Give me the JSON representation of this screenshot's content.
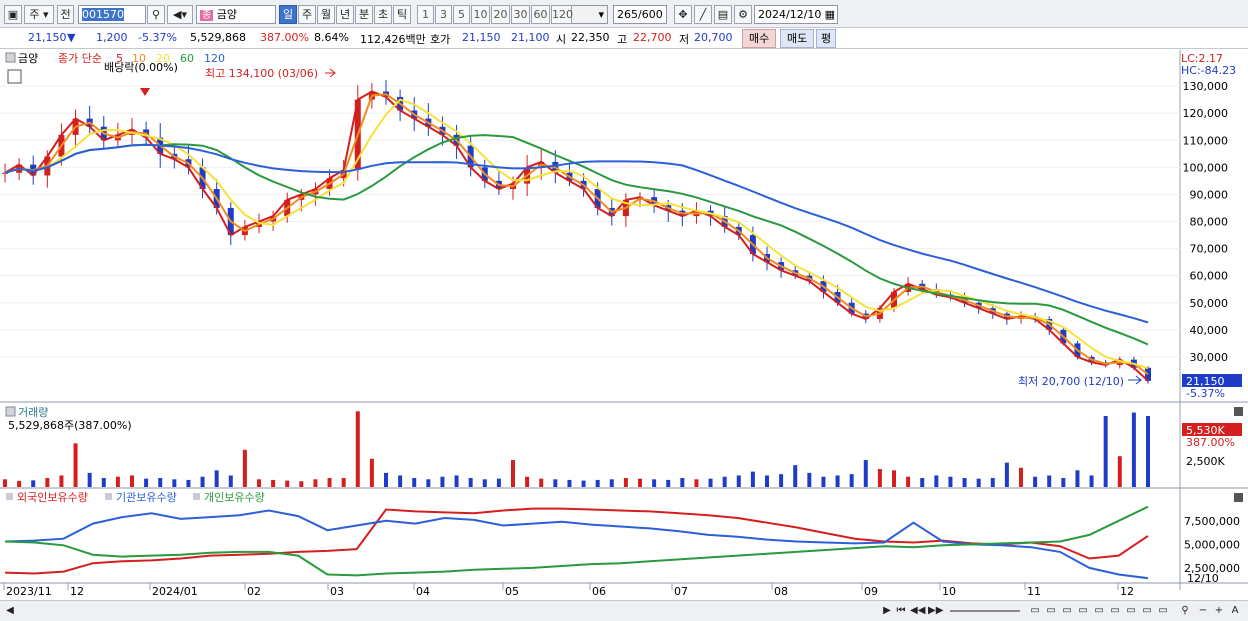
{
  "toolbar": {
    "period_mode": "주",
    "prev_label": "전",
    "stock_code": "001570",
    "stock_name": "금양",
    "intervals": [
      "일",
      "주",
      "월",
      "년",
      "분",
      "초",
      "틱"
    ],
    "active_interval": "일",
    "numbers": [
      "1",
      "3",
      "5",
      "10",
      "20",
      "30",
      "60",
      "120"
    ],
    "count_value": "265",
    "count_total": "/600",
    "date": "2024/12/10"
  },
  "quote": {
    "price": "21,150",
    "change": "1,200",
    "change_pct": "-5.37%",
    "volume": "5,529,868",
    "volume_pct": "387.00%",
    "turnover": "8.64%",
    "amount": "112,426백만",
    "bid_label": "호가",
    "ask": "21,150",
    "bid": "21,100",
    "open_label": "시",
    "open": "22,350",
    "high_label": "고",
    "high": "22,700",
    "low_label": "저",
    "low": "20,700",
    "buy_label": "매수",
    "sell_label": "매도",
    "eval_label": "평"
  },
  "price_panel": {
    "name": "금양",
    "series_label": "종가 단순",
    "ma_periods": [
      "5",
      "10",
      "20",
      "60",
      "120"
    ],
    "ma_colors": [
      "#d41f1f",
      "#f08c1e",
      "#f5e23a",
      "#2a9a3e",
      "#2c5fd8"
    ],
    "dividend_label": "배당락(0.00%)",
    "high_note": "최고 134,100 (03/06)",
    "low_note": "최저 20,700 (12/10)",
    "lc": "LC:2.17",
    "hc": "HC:-84.23",
    "last_price": "21,150",
    "last_pct": "-5.37%",
    "y_ticks": [
      "130,000",
      "120,000",
      "110,000",
      "100,000",
      "90,000",
      "80,000",
      "70,000",
      "60,000",
      "50,000",
      "40,000",
      "30,000"
    ]
  },
  "volume_panel": {
    "title": "거래량",
    "value": "5,529,868주(387.00%)",
    "last_badge": "5,530K",
    "last_pct": "387.00%",
    "y_tick": "2,500K"
  },
  "holding_panel": {
    "legend": [
      "외국인보유수량",
      "기관보유수량",
      "개인보유수량"
    ],
    "legend_colors": [
      "#d41f1f",
      "#2c5fd8",
      "#2a9a3e"
    ],
    "y_ticks": [
      "7,500,000",
      "5,000,000",
      "2,500,000"
    ]
  },
  "x_axis": {
    "labels": [
      "2023/11",
      "12",
      "2024/01",
      "02",
      "03",
      "04",
      "05",
      "06",
      "07",
      "08",
      "09",
      "10",
      "11",
      "12"
    ],
    "right_label": "12/10"
  },
  "chart_data": {
    "type": "candlestick",
    "note_high": {
      "date": "03/06",
      "value": 134100
    },
    "note_low": {
      "date": "12/10",
      "value": 20700
    },
    "close_series": [
      98000,
      101000,
      97000,
      104000,
      112000,
      118000,
      115000,
      110000,
      112000,
      114000,
      111000,
      105000,
      103000,
      100000,
      92000,
      85000,
      75000,
      78000,
      80000,
      82000,
      88000,
      90000,
      92000,
      96000,
      99000,
      125000,
      128000,
      126000,
      121000,
      118000,
      115000,
      112000,
      108000,
      100000,
      95000,
      92000,
      94000,
      100000,
      102000,
      98000,
      95000,
      92000,
      85000,
      82000,
      88000,
      89000,
      86000,
      84000,
      82000,
      84000,
      82000,
      78000,
      75000,
      68000,
      65000,
      62000,
      60000,
      58000,
      54000,
      50000,
      46000,
      44000,
      48000,
      54000,
      57000,
      55000,
      53000,
      52000,
      50000,
      48000,
      46000,
      44000,
      45000,
      44000,
      40000,
      35000,
      30000,
      28000,
      27000,
      29000,
      26000,
      21150
    ],
    "volume_series_k": [
      600,
      480,
      520,
      700,
      900,
      3400,
      1100,
      700,
      800,
      900,
      650,
      700,
      600,
      550,
      800,
      1300,
      900,
      2900,
      600,
      550,
      500,
      450,
      600,
      700,
      700,
      5900,
      2200,
      1100,
      900,
      700,
      600,
      800,
      900,
      700,
      600,
      650,
      2100,
      800,
      650,
      600,
      550,
      500,
      550,
      600,
      700,
      650,
      600,
      550,
      700,
      600,
      650,
      800,
      900,
      1200,
      900,
      1000,
      1700,
      1100,
      800,
      900,
      1000,
      2100,
      1400,
      1300,
      800,
      700,
      900,
      800,
      700,
      650,
      700,
      1900,
      1500,
      800,
      900,
      700,
      1300,
      900,
      5530,
      2400,
      5800,
      5530
    ],
    "foreign_holding": [
      2000000,
      1900000,
      2100000,
      3000000,
      3200000,
      3300000,
      3500000,
      3800000,
      3900000,
      4000000,
      4200000,
      4300000,
      4500000,
      8700000,
      8500000,
      8400000,
      8300000,
      8600000,
      8800000,
      8800000,
      8700000,
      8600000,
      8500000,
      8300000,
      8100000,
      7800000,
      7300000,
      6800000,
      6200000,
      5600000,
      5300000,
      5200000,
      5400000,
      5100000,
      5000000,
      5200000,
      4800000,
      3500000,
      3800000,
      5900000
    ],
    "institution_holding": [
      5300000,
      5400000,
      5600000,
      7200000,
      7900000,
      8300000,
      7700000,
      7900000,
      8100000,
      8600000,
      8000000,
      6500000,
      7000000,
      7500000,
      7200000,
      7800000,
      7600000,
      7000000,
      7200000,
      7400000,
      7100000,
      6900000,
      6700000,
      6400000,
      6000000,
      5800000,
      5500000,
      5300000,
      5200000,
      5100000,
      5200000,
      7300000,
      5300000,
      5000000,
      4900000,
      4700000,
      4200000,
      2500000,
      1800000,
      1400000
    ],
    "individual_holding": [
      5300000,
      5200000,
      4900000,
      3900000,
      3700000,
      3800000,
      3900000,
      4100000,
      4200000,
      4200000,
      3800000,
      1800000,
      1700000,
      1900000,
      2000000,
      2100000,
      2300000,
      2400000,
      2500000,
      2700000,
      2900000,
      3000000,
      3200000,
      3400000,
      3600000,
      3800000,
      4000000,
      4200000,
      4400000,
      4600000,
      4800000,
      4700000,
      4900000,
      5000000,
      5100000,
      5200000,
      5300000,
      6000000,
      7500000,
      9000000
    ]
  }
}
